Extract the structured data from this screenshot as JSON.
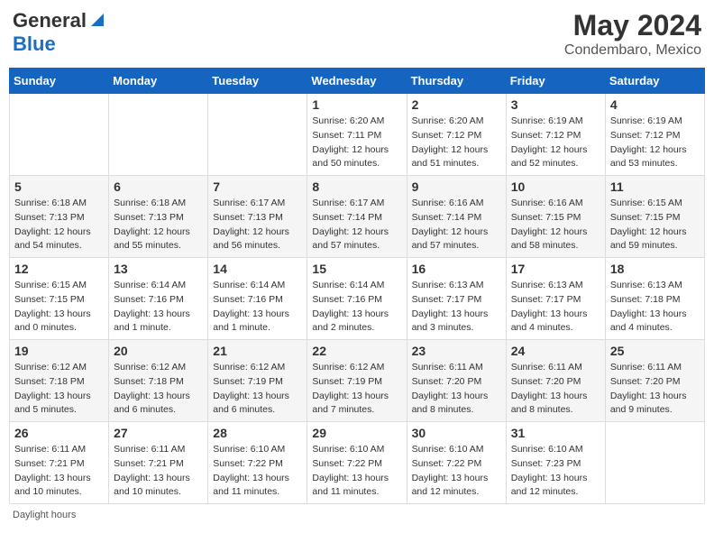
{
  "header": {
    "logo_general": "General",
    "logo_blue": "Blue",
    "month_year": "May 2024",
    "location": "Condembaro, Mexico"
  },
  "days_of_week": [
    "Sunday",
    "Monday",
    "Tuesday",
    "Wednesday",
    "Thursday",
    "Friday",
    "Saturday"
  ],
  "weeks": [
    [
      {
        "day": "",
        "detail": ""
      },
      {
        "day": "",
        "detail": ""
      },
      {
        "day": "",
        "detail": ""
      },
      {
        "day": "1",
        "detail": "Sunrise: 6:20 AM\nSunset: 7:11 PM\nDaylight: 12 hours\nand 50 minutes."
      },
      {
        "day": "2",
        "detail": "Sunrise: 6:20 AM\nSunset: 7:12 PM\nDaylight: 12 hours\nand 51 minutes."
      },
      {
        "day": "3",
        "detail": "Sunrise: 6:19 AM\nSunset: 7:12 PM\nDaylight: 12 hours\nand 52 minutes."
      },
      {
        "day": "4",
        "detail": "Sunrise: 6:19 AM\nSunset: 7:12 PM\nDaylight: 12 hours\nand 53 minutes."
      }
    ],
    [
      {
        "day": "5",
        "detail": "Sunrise: 6:18 AM\nSunset: 7:13 PM\nDaylight: 12 hours\nand 54 minutes."
      },
      {
        "day": "6",
        "detail": "Sunrise: 6:18 AM\nSunset: 7:13 PM\nDaylight: 12 hours\nand 55 minutes."
      },
      {
        "day": "7",
        "detail": "Sunrise: 6:17 AM\nSunset: 7:13 PM\nDaylight: 12 hours\nand 56 minutes."
      },
      {
        "day": "8",
        "detail": "Sunrise: 6:17 AM\nSunset: 7:14 PM\nDaylight: 12 hours\nand 57 minutes."
      },
      {
        "day": "9",
        "detail": "Sunrise: 6:16 AM\nSunset: 7:14 PM\nDaylight: 12 hours\nand 57 minutes."
      },
      {
        "day": "10",
        "detail": "Sunrise: 6:16 AM\nSunset: 7:15 PM\nDaylight: 12 hours\nand 58 minutes."
      },
      {
        "day": "11",
        "detail": "Sunrise: 6:15 AM\nSunset: 7:15 PM\nDaylight: 12 hours\nand 59 minutes."
      }
    ],
    [
      {
        "day": "12",
        "detail": "Sunrise: 6:15 AM\nSunset: 7:15 PM\nDaylight: 13 hours\nand 0 minutes."
      },
      {
        "day": "13",
        "detail": "Sunrise: 6:14 AM\nSunset: 7:16 PM\nDaylight: 13 hours\nand 1 minute."
      },
      {
        "day": "14",
        "detail": "Sunrise: 6:14 AM\nSunset: 7:16 PM\nDaylight: 13 hours\nand 1 minute."
      },
      {
        "day": "15",
        "detail": "Sunrise: 6:14 AM\nSunset: 7:16 PM\nDaylight: 13 hours\nand 2 minutes."
      },
      {
        "day": "16",
        "detail": "Sunrise: 6:13 AM\nSunset: 7:17 PM\nDaylight: 13 hours\nand 3 minutes."
      },
      {
        "day": "17",
        "detail": "Sunrise: 6:13 AM\nSunset: 7:17 PM\nDaylight: 13 hours\nand 4 minutes."
      },
      {
        "day": "18",
        "detail": "Sunrise: 6:13 AM\nSunset: 7:18 PM\nDaylight: 13 hours\nand 4 minutes."
      }
    ],
    [
      {
        "day": "19",
        "detail": "Sunrise: 6:12 AM\nSunset: 7:18 PM\nDaylight: 13 hours\nand 5 minutes."
      },
      {
        "day": "20",
        "detail": "Sunrise: 6:12 AM\nSunset: 7:18 PM\nDaylight: 13 hours\nand 6 minutes."
      },
      {
        "day": "21",
        "detail": "Sunrise: 6:12 AM\nSunset: 7:19 PM\nDaylight: 13 hours\nand 6 minutes."
      },
      {
        "day": "22",
        "detail": "Sunrise: 6:12 AM\nSunset: 7:19 PM\nDaylight: 13 hours\nand 7 minutes."
      },
      {
        "day": "23",
        "detail": "Sunrise: 6:11 AM\nSunset: 7:20 PM\nDaylight: 13 hours\nand 8 minutes."
      },
      {
        "day": "24",
        "detail": "Sunrise: 6:11 AM\nSunset: 7:20 PM\nDaylight: 13 hours\nand 8 minutes."
      },
      {
        "day": "25",
        "detail": "Sunrise: 6:11 AM\nSunset: 7:20 PM\nDaylight: 13 hours\nand 9 minutes."
      }
    ],
    [
      {
        "day": "26",
        "detail": "Sunrise: 6:11 AM\nSunset: 7:21 PM\nDaylight: 13 hours\nand 10 minutes."
      },
      {
        "day": "27",
        "detail": "Sunrise: 6:11 AM\nSunset: 7:21 PM\nDaylight: 13 hours\nand 10 minutes."
      },
      {
        "day": "28",
        "detail": "Sunrise: 6:10 AM\nSunset: 7:22 PM\nDaylight: 13 hours\nand 11 minutes."
      },
      {
        "day": "29",
        "detail": "Sunrise: 6:10 AM\nSunset: 7:22 PM\nDaylight: 13 hours\nand 11 minutes."
      },
      {
        "day": "30",
        "detail": "Sunrise: 6:10 AM\nSunset: 7:22 PM\nDaylight: 13 hours\nand 12 minutes."
      },
      {
        "day": "31",
        "detail": "Sunrise: 6:10 AM\nSunset: 7:23 PM\nDaylight: 13 hours\nand 12 minutes."
      },
      {
        "day": "",
        "detail": ""
      }
    ]
  ],
  "footer": {
    "daylight_hours": "Daylight hours"
  }
}
